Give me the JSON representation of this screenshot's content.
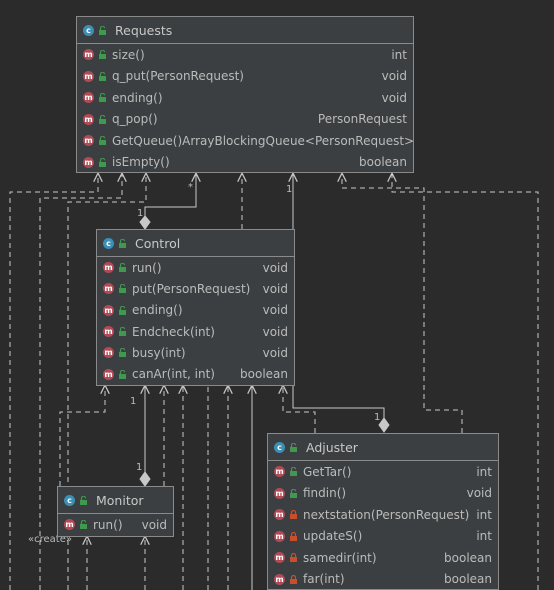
{
  "colors": {
    "background": "#2b2b2b",
    "class_fill": "#3c3f41",
    "border": "#8a8a8a",
    "text": "#bbbbbb",
    "class_badge": "#3c8fb5",
    "method_badge": "#b24a55",
    "public_lock": "#3f9a4f",
    "private_lock": "#c94f2c"
  },
  "badge_letters": {
    "class": "c",
    "method": "m"
  },
  "icons": {
    "class_badge": "class-badge-icon",
    "method_badge": "method-badge-icon",
    "public_visibility": "unlock-icon",
    "private_visibility": "lock-icon",
    "composition": "diamond-icon",
    "arrow": "arrowhead-icon"
  },
  "classes": {
    "requests": {
      "name": "Requests",
      "methods": [
        {
          "name": "size()",
          "type": "int",
          "visibility": "public"
        },
        {
          "name": "q_put(PersonRequest)",
          "type": "void",
          "visibility": "public"
        },
        {
          "name": "ending()",
          "type": "void",
          "visibility": "public"
        },
        {
          "name": "q_pop()",
          "type": "PersonRequest",
          "visibility": "public"
        },
        {
          "name": "GetQueue()",
          "type": "ArrayBlockingQueue<PersonRequest>",
          "visibility": "public"
        },
        {
          "name": "isEmpty()",
          "type": "boolean",
          "visibility": "public"
        }
      ]
    },
    "control": {
      "name": "Control",
      "methods": [
        {
          "name": "run()",
          "type": "void",
          "visibility": "public"
        },
        {
          "name": "put(PersonRequest)",
          "type": "void",
          "visibility": "public"
        },
        {
          "name": "ending()",
          "type": "void",
          "visibility": "public"
        },
        {
          "name": "Endcheck(int)",
          "type": "void",
          "visibility": "public"
        },
        {
          "name": "busy(int)",
          "type": "void",
          "visibility": "public"
        },
        {
          "name": "canAr(int, int)",
          "type": "boolean",
          "visibility": "public"
        }
      ]
    },
    "monitor": {
      "name": "Monitor",
      "methods": [
        {
          "name": "run()",
          "type": "void",
          "visibility": "public"
        }
      ]
    },
    "adjuster": {
      "name": "Adjuster",
      "methods": [
        {
          "name": "GetTar()",
          "type": "int",
          "visibility": "public"
        },
        {
          "name": "findin()",
          "type": "void",
          "visibility": "public"
        },
        {
          "name": "nextstation(PersonRequest)",
          "type": "int",
          "visibility": "private"
        },
        {
          "name": "updateS()",
          "type": "int",
          "visibility": "private"
        },
        {
          "name": "samedir(int)",
          "type": "boolean",
          "visibility": "private"
        },
        {
          "name": "far(int)",
          "type": "boolean",
          "visibility": "private"
        }
      ]
    }
  },
  "multiplicities": {
    "requests_to_control_target": "*",
    "requests_to_control_source": "1",
    "requests_to_adjuster_target": "1",
    "requests_to_adjuster_source": "1",
    "control_to_monitor_target": "1",
    "control_to_monitor_source": "1"
  },
  "stereotypes": {
    "create": "«create»"
  }
}
